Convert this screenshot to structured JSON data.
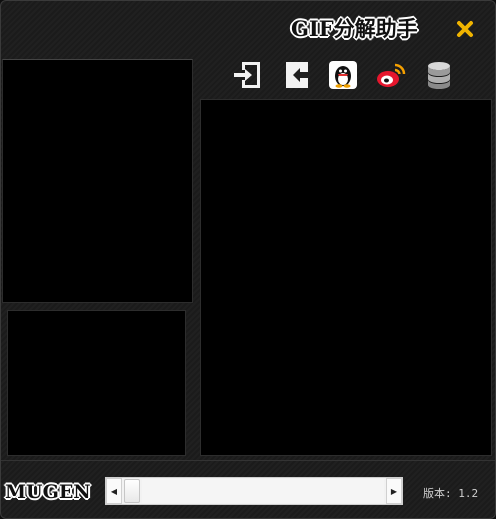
{
  "window": {
    "title": "GIF分解助手",
    "close_icon": "close-icon",
    "accent_color": "#f0b400"
  },
  "toolbar": {
    "items": [
      {
        "icon": "import-icon"
      },
      {
        "icon": "export-icon"
      },
      {
        "icon": "qq-icon"
      },
      {
        "icon": "weibo-icon"
      },
      {
        "icon": "database-icon"
      }
    ]
  },
  "footer": {
    "logo": "MUGEN",
    "version_label": "版本:",
    "version_value": "1.2",
    "slider": {
      "value": 0,
      "left_arrow": "◀",
      "right_arrow": "▶"
    }
  }
}
